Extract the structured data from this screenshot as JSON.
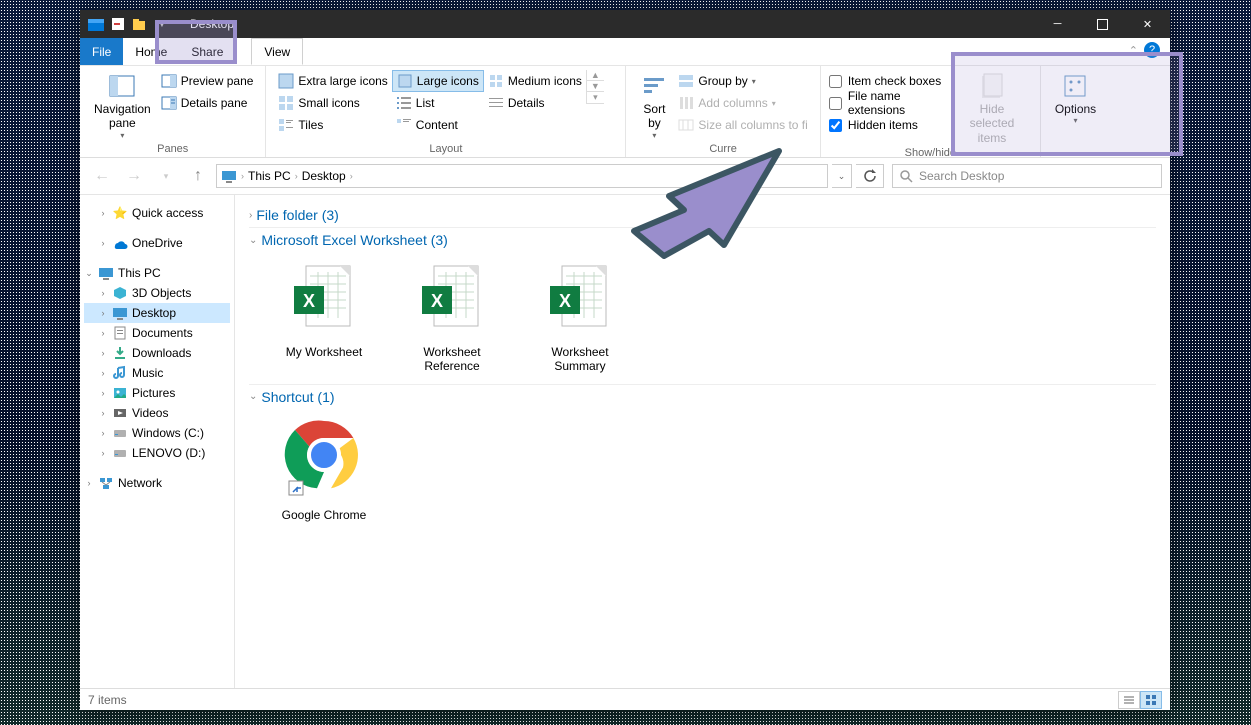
{
  "titlebar": {
    "title": "Desktop"
  },
  "tabs": {
    "file": "File",
    "home": "Home",
    "share": "Share",
    "view": "View"
  },
  "ribbon": {
    "panes": {
      "nav_pane": "Navigation\npane",
      "preview_pane": "Preview pane",
      "details_pane": "Details pane",
      "group_label": "Panes"
    },
    "layout": {
      "extra_large": "Extra large icons",
      "large": "Large icons",
      "medium": "Medium icons",
      "small": "Small icons",
      "list": "List",
      "details": "Details",
      "tiles": "Tiles",
      "content": "Content",
      "group_label": "Layout"
    },
    "current_view": {
      "sort_by": "Sort\nby",
      "group_by": "Group by",
      "add_columns": "Add columns",
      "size_all": "Size all columns to fi",
      "group_label": "Curre"
    },
    "show_hide": {
      "item_check_boxes": "Item check boxes",
      "file_name_ext": "File name extensions",
      "hidden_items": "Hidden items",
      "hide_selected": "Hide selected\nitems",
      "group_label": "Show/hide"
    },
    "options": "Options"
  },
  "nav": {
    "crumb1": "This PC",
    "crumb2": "Desktop",
    "search_placeholder": "Search Desktop"
  },
  "sidebar": {
    "quick_access": "Quick access",
    "onedrive": "OneDrive",
    "this_pc": "This PC",
    "objects3d": "3D Objects",
    "desktop": "Desktop",
    "documents": "Documents",
    "downloads": "Downloads",
    "music": "Music",
    "pictures": "Pictures",
    "videos": "Videos",
    "windows_c": "Windows (C:)",
    "lenovo_d": "LENOVO (D:)",
    "network": "Network"
  },
  "content": {
    "groups": {
      "file_folder": {
        "label": "File folder (3)"
      },
      "excel": {
        "label": "Microsoft Excel Worksheet (3)",
        "items": [
          "My Worksheet",
          "Worksheet Reference",
          "Worksheet Summary"
        ]
      },
      "shortcut": {
        "label": "Shortcut (1)",
        "items": [
          "Google Chrome"
        ]
      }
    }
  },
  "statusbar": {
    "count": "7 items"
  }
}
